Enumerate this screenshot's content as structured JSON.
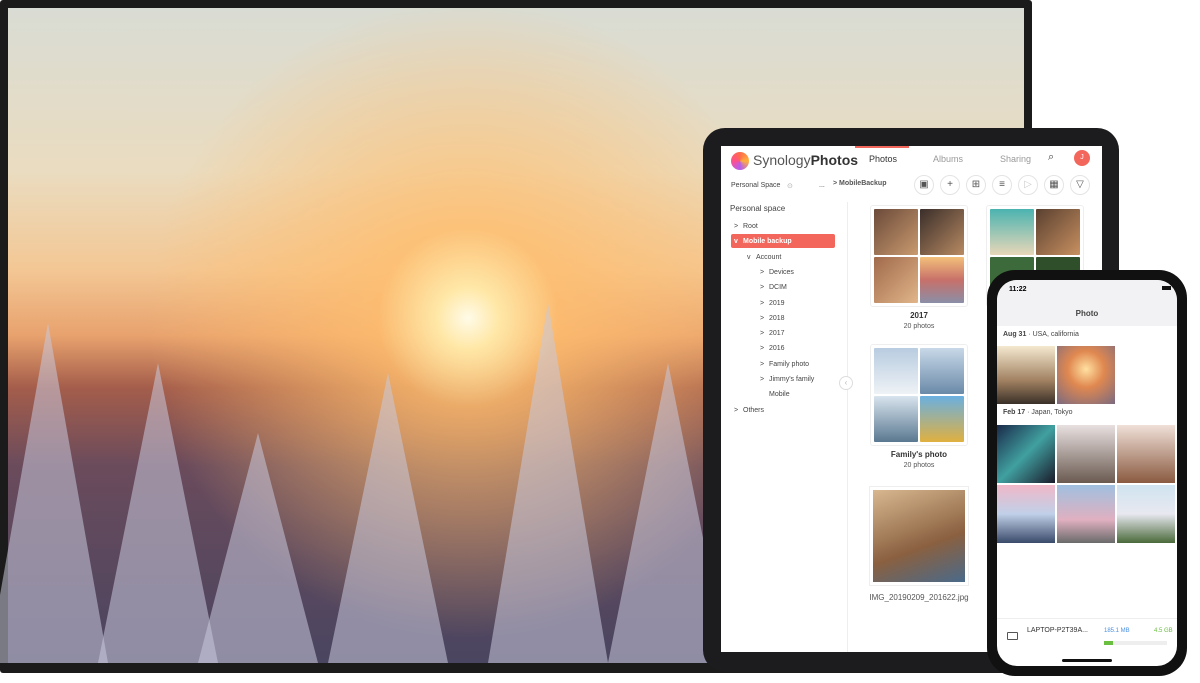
{
  "tablet": {
    "app": {
      "brand_light": "Synology",
      "brand_bold": "Photos",
      "accent": "#f2665b"
    },
    "tabs": [
      {
        "label": "Photos",
        "active": true
      },
      {
        "label": "Albums"
      },
      {
        "label": "Sharing"
      }
    ],
    "avatar_initial": "J",
    "toolbar": {
      "space_selector": "Personal Space",
      "ellipsis": "...",
      "breadcrumb": "> MobileBackup",
      "icons": [
        "image-icon",
        "plus-icon",
        "add-folder-icon",
        "sort-icon",
        "slideshow-icon",
        "calendar-icon",
        "filter-icon"
      ]
    },
    "sidebar": {
      "title": "Personal space",
      "items": [
        {
          "label": "Root",
          "level": 0,
          "chevron": ">"
        },
        {
          "label": "Mobile backup",
          "level": 0,
          "chevron": "v",
          "selected": true
        },
        {
          "label": "Account",
          "level": 1,
          "chevron": "v"
        },
        {
          "label": "Devices",
          "level": 2,
          "chevron": ">"
        },
        {
          "label": "DCIM",
          "level": 2,
          "chevron": ">"
        },
        {
          "label": "2019",
          "level": 2,
          "chevron": ">"
        },
        {
          "label": "2018",
          "level": 2,
          "chevron": ">"
        },
        {
          "label": "2017",
          "level": 2,
          "chevron": ">"
        },
        {
          "label": "2016",
          "level": 2,
          "chevron": ">"
        },
        {
          "label": "Family photo",
          "level": 2,
          "chevron": ">"
        },
        {
          "label": "Jimmy's family",
          "level": 2,
          "chevron": ">"
        },
        {
          "label": "Mobile",
          "level": 2,
          "chevron": ""
        },
        {
          "label": "Others",
          "level": 0,
          "chevron": ">"
        }
      ]
    },
    "folders": [
      {
        "name": "2017",
        "count": "20 photos"
      },
      {
        "name": "Family's photo",
        "count": "20 photos"
      },
      {
        "name": "IMG_20190209_201622.jpg",
        "count": ""
      }
    ]
  },
  "phone": {
    "time": "11:22",
    "title": "Photo",
    "groups": [
      {
        "date": "Aug 31",
        "place": "· USA, california"
      },
      {
        "date": "Feb 17",
        "place": "· Japan, Tokyo"
      }
    ],
    "backup": {
      "device": "LAPTOP-P2T39A...",
      "uploaded": "185.1 MB",
      "total": "4.5 GB",
      "progress": 0.15,
      "uploaded_color": "#4a90e2",
      "total_color": "#6abf40"
    }
  }
}
